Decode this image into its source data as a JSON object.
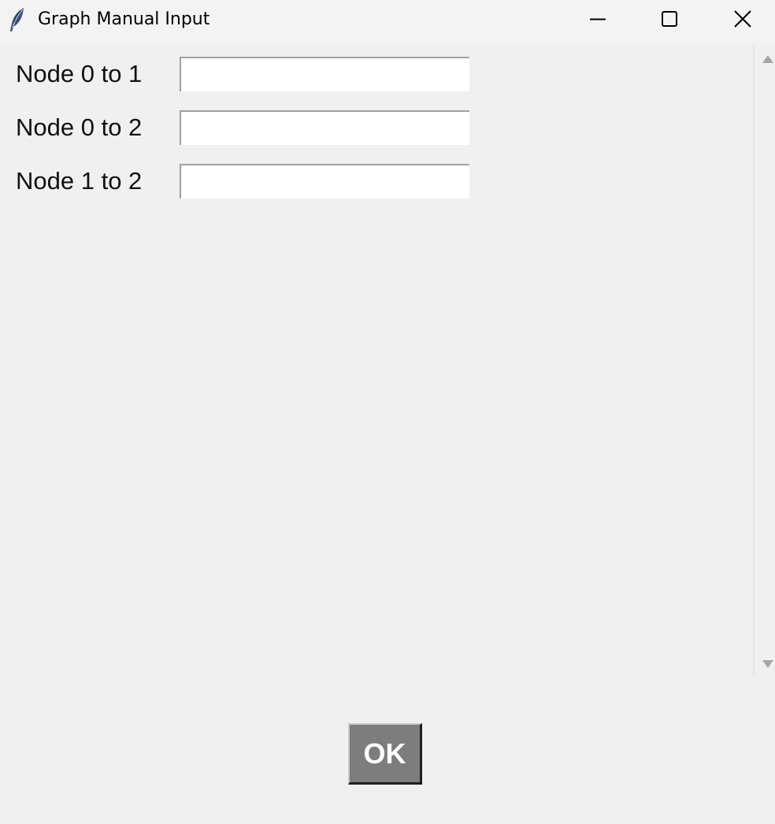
{
  "window": {
    "title": "Graph Manual Input",
    "app_icon": "tk-feather-icon",
    "controls": {
      "minimize_icon": "minimize-icon",
      "maximize_icon": "maximize-icon",
      "close_icon": "close-icon"
    }
  },
  "form": {
    "fields": [
      {
        "label": "Node 0 to 1",
        "value": ""
      },
      {
        "label": "Node 0 to 2",
        "value": ""
      },
      {
        "label": "Node 1 to 2",
        "value": ""
      }
    ]
  },
  "scrollbar": {
    "up_icon": "scroll-up-arrow-icon",
    "down_icon": "scroll-down-arrow-icon"
  },
  "actions": {
    "ok_label": "OK"
  },
  "colors": {
    "background": "#f0f0f0",
    "titlebar": "#f3f3f3",
    "button_face": "#7d7d7d",
    "button_text": "#ffffff",
    "input_background": "#ffffff"
  }
}
